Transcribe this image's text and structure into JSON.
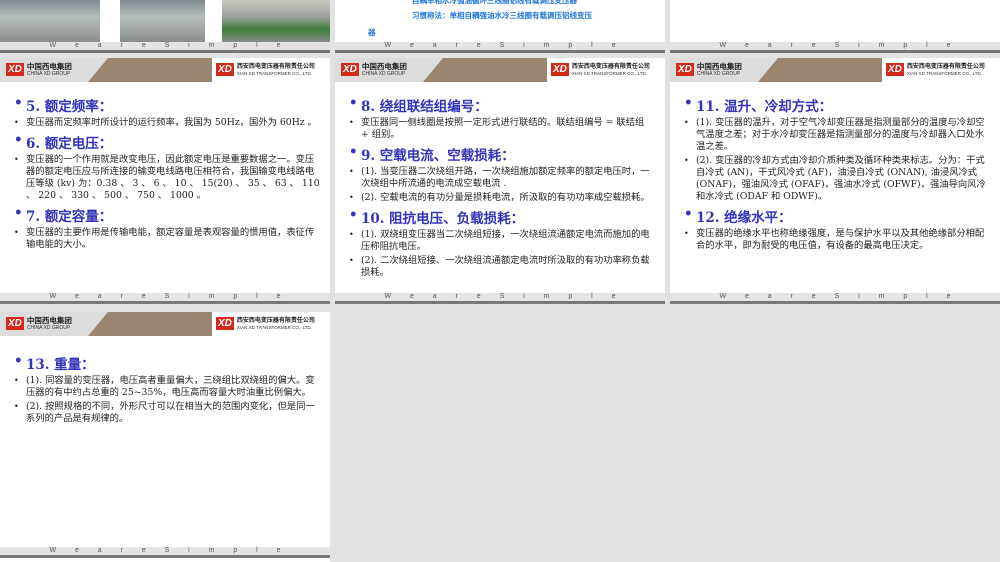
{
  "footer_text": [
    "W",
    "e",
    "a",
    "r",
    "e",
    "S",
    "i",
    "m",
    "p",
    "l",
    "e"
  ],
  "logo": {
    "left_cn": "中国西电集团",
    "left_en": "CHINA XD GROUP",
    "right_cn": "西安西电变压器有限责任公司",
    "right_en": "XIAN XD TRANSFORMER CO., LTD.",
    "mark": "XD"
  },
  "top_slide": {
    "line1": "自耦单相水冷强油循环三线圈铝线有载调压变压器",
    "line2": "习惯称法：单相自耦强油水冷三线圈有载调压铝线变压",
    "line3": "器"
  },
  "slides": [
    {
      "sections": [
        {
          "title": "5. 额定频率：",
          "items": [
            "变压器而定频率时所设计的运行频率，我国为 50Hz，国外为 60Hz 。"
          ]
        },
        {
          "title": "6. 额定电压：",
          "items": [
            "变压器的一个作用就是改变电压，因此额定电压是重要数据之一。变压器的额定电压应与所连接的输变电线路电压相符合，我国输变电线路电压等级 (kv) 为：0.38 、 3 、 6 、 10 、 15(20) 、 35 、 63 、 110 、 220 、 330 、 500 、 750 、 1000 。"
          ]
        },
        {
          "title": "7. 额定容量：",
          "items": [
            "变压器的主要作用是传输电能，额定容量是表观容量的惯用值，表征传输电能的大小。"
          ]
        }
      ]
    },
    {
      "sections": [
        {
          "title": "8. 绕组联结组编号：",
          "items": [
            "变压器同一侧线圈是按照一定形式进行联结的。联结组编号 = 联结组 + 组别。"
          ]
        },
        {
          "title": "9. 空载电流、空载损耗：",
          "items": [
            "(1). 当变压器二次绕组开路，一次绕组施加额定频率的额定电压时，一次绕组中所流通的电流成空载电流 .",
            "(2). 空载电流的有功分量是损耗电流，所汲取的有功功率成空载损耗。"
          ]
        },
        {
          "title": "10. 阻抗电压、负载损耗：",
          "items": [
            "(1). 双绕组变压器当二次绕组短接，一次绕组流通额定电流而施加的电压称阻抗电压。",
            "(2). 二次绕组短接、一次绕组流通额定电流时所汲取的有功功率称负载损耗。"
          ]
        }
      ]
    },
    {
      "sections": [
        {
          "title": "11. 温升、冷却方式：",
          "items": [
            "(1). 变压器的温升，对于空气冷却变压器是指测量部分的温度与冷却空气温度之差；对于水冷却变压器是指测量部分的温度与冷却器入口处水温之差。",
            "(2). 变压器的冷却方式由冷却介质种类及循环种类来标志。分为：干式自冷式 (AN)，干式风冷式 (AF)，油浸自冷式 (ONAN), 油浸风冷式 (ONAF)，强油风冷式 (OFAF)，强油水冷式 (OFWF)，强油导向风冷和水冷式 (ODAF 和 ODWF)。"
          ]
        },
        {
          "title": "12. 绝缘水平：",
          "items": [
            "变压器的绝缘水平也称绝缘强度，是与保护水平以及其他绝缘部分相配合的水平，即为耐受的电压值，有设备的最高电压决定。"
          ]
        }
      ]
    },
    {
      "sections": [
        {
          "title": "13. 重量：",
          "items": [
            "(1). 同容量的变压器，电压高者重量偏大，三绕组比双绕组的偏大。变压器的有中约占总重的 25~35%，电压高而容量大时油重比例偏大。",
            "(2). 按照规格的不同，外形尺寸可以在相当大的范围内变化，但是同一系列的产品是有规律的。"
          ]
        }
      ]
    }
  ]
}
